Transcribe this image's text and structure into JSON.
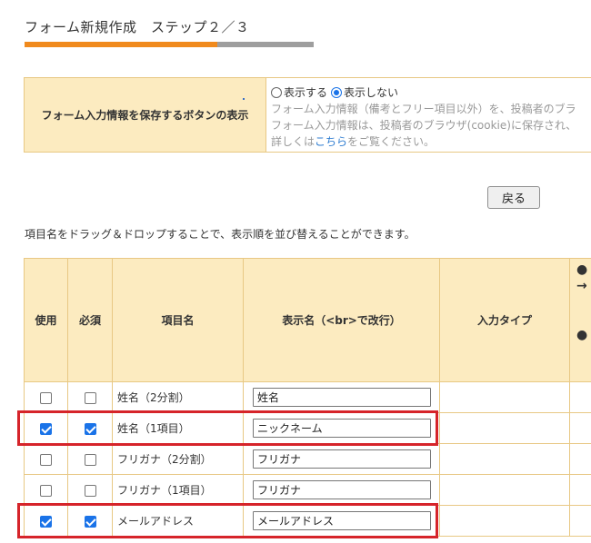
{
  "header": {
    "title": "フォーム新規作成　ステップ２／３",
    "progress_fraction": 0.667,
    "colors": {
      "progress": "#f08a1d",
      "track": "#9e9e9e"
    }
  },
  "save_setting": {
    "label": "フォーム入力情報を保存するボタンの表示",
    "options": [
      {
        "label": "表示する",
        "selected": false
      },
      {
        "label": "表示しない",
        "selected": true
      }
    ],
    "note_line1": "フォーム入力情報（備考とフリー項目以外）を、投稿者のブラ",
    "note_line2": "フォーム入力情報は、投稿者のブラウザ(cookie)に保存され、",
    "note_line3_prefix": "詳しくは",
    "note_link": "こちら",
    "note_line3_suffix": "をご覧ください。"
  },
  "back_button": {
    "label": "戻る"
  },
  "instruction": "項目名をドラッグ＆ドロップすることで、表示順を並び替えることができます。",
  "items_table": {
    "headers": {
      "use": "使用",
      "required": "必須",
      "item_name": "項目名",
      "display_name": "表示名（<br>で改行）",
      "input_type": "入力タイプ",
      "note_bullet": "●",
      "note_arrow": "→",
      "note_bullet2": "●"
    },
    "rows": [
      {
        "use": false,
        "required": false,
        "name": "姓名（2分割）",
        "display": "姓名",
        "highlighted": false
      },
      {
        "use": true,
        "required": true,
        "name": "姓名（1項目）",
        "display": "ニックネーム",
        "highlighted": true
      },
      {
        "use": false,
        "required": false,
        "name": "フリガナ（2分割）",
        "display": "フリガナ",
        "highlighted": false
      },
      {
        "use": false,
        "required": false,
        "name": "フリガナ（1項目）",
        "display": "フリガナ",
        "highlighted": false
      },
      {
        "use": true,
        "required": true,
        "name": "メールアドレス",
        "display": "メールアドレス",
        "highlighted": true
      }
    ],
    "highlight_color": "#d6242a"
  }
}
